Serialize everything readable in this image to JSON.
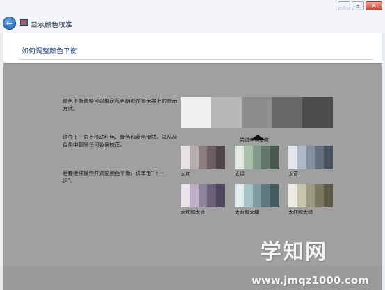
{
  "window": {
    "title": "显示颜色校准",
    "controls": [
      "minimize",
      "maximize",
      "close"
    ]
  },
  "header": {
    "heading": "如何调整颜色平衡"
  },
  "instructions": [
    "颜色平衡调整可以确定灰色阴影在显示器上的显示方式。",
    "请在下一页上移动红色、绿色和蓝色滑块，以从灰色条中删除任何色偏校正。",
    "若要继续操作并调整颜色平衡，请单击“下一步”。"
  ],
  "gray_bar": {
    "colors": [
      "#f0f0f0",
      "#b6b6b6",
      "#8d8d8d",
      "#686868",
      "#4c4c4c"
    ],
    "caption": "尝试中等灰度"
  },
  "swatches": [
    {
      "label": "太红",
      "colors": [
        "#e7e3e3",
        "#b7abab",
        "#8d7f80",
        "#6a5e60",
        "#4f4446"
      ]
    },
    {
      "label": "太绿",
      "colors": [
        "#e3e8e3",
        "#abc0ab",
        "#83998a",
        "#62776a",
        "#475a4d"
      ]
    },
    {
      "label": "太蓝",
      "colors": [
        "#e3e6ec",
        "#aeb8c8",
        "#83909f",
        "#636e7e",
        "#48505e"
      ]
    },
    {
      "label": "太红和太蓝",
      "colors": [
        "#e9e3ec",
        "#bbaec6",
        "#8f829d",
        "#6b607a",
        "#4f465c"
      ]
    },
    {
      "label": "太蓝和太绿",
      "colors": [
        "#e3ebec",
        "#a9c4c6",
        "#7f9aa0",
        "#5e797d",
        "#445b5f"
      ]
    },
    {
      "label": "太红和太绿",
      "colors": [
        "#ebebe3",
        "#c5c5ac",
        "#9a9a83",
        "#777762",
        "#5a5a47"
      ]
    }
  ],
  "watermark": {
    "brand": "学知网",
    "url": "www.jmqz1000.com"
  },
  "colors": {
    "content_bg": "#a0a0a0",
    "header_bg": "#ffffff",
    "heading_text": "#1f3f85"
  }
}
